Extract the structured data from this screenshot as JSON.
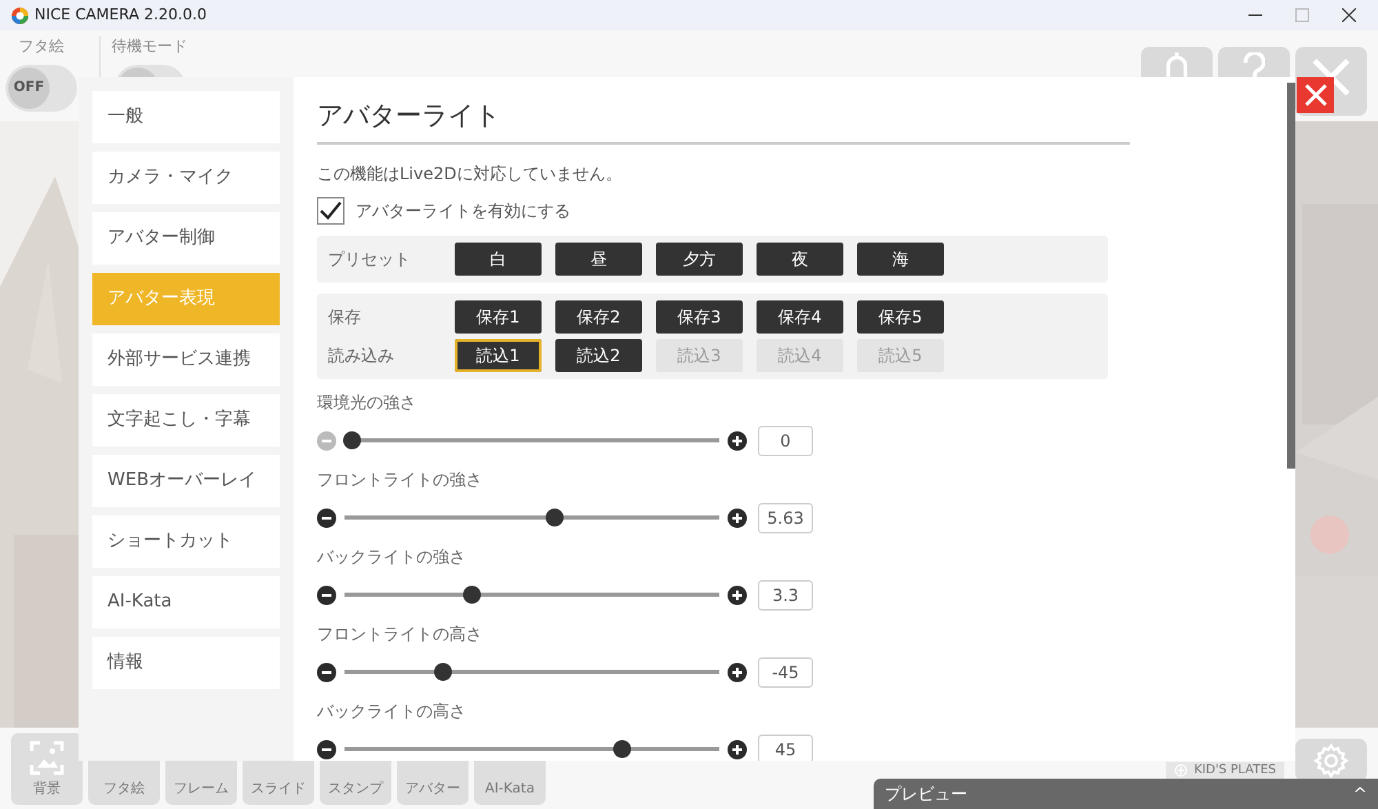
{
  "window": {
    "title": "NICE CAMERA 2.20.0.0"
  },
  "app": {
    "top_toggles": [
      {
        "label": "フタ絵",
        "state_text": "OFF",
        "on": false
      },
      {
        "label": "待機モード",
        "on": false
      }
    ],
    "bottom_toolbar": [
      {
        "label": "背景"
      },
      {
        "label": "フタ絵"
      },
      {
        "label": "フレーム"
      },
      {
        "label": "スライド"
      },
      {
        "label": "スタンプ"
      },
      {
        "label": "アバター"
      },
      {
        "label": "AI-Kata"
      }
    ],
    "badge": "KID'S PLATES",
    "preview_bar": {
      "label": "プレビュー",
      "toggle": "^"
    }
  },
  "settings": {
    "sidebar": [
      {
        "label": "一般",
        "selected": false
      },
      {
        "label": "カメラ・マイク",
        "selected": false
      },
      {
        "label": "アバター制御",
        "selected": false
      },
      {
        "label": "アバター表現",
        "selected": true
      },
      {
        "label": "外部サービス連携",
        "selected": false
      },
      {
        "label": "文字起こし・字幕",
        "selected": false
      },
      {
        "label": "WEBオーバーレイ",
        "selected": false
      },
      {
        "label": "ショートカット",
        "selected": false
      },
      {
        "label": "AI-Kata",
        "selected": false
      },
      {
        "label": "情報",
        "selected": false
      }
    ],
    "title": "アバターライト",
    "notice": "この機能はLive2Dに対応していません。",
    "enable": {
      "label": "アバターライトを有効にする",
      "checked": true
    },
    "preset": {
      "label": "プリセット",
      "buttons": [
        "白",
        "昼",
        "夕方",
        "夜",
        "海"
      ]
    },
    "save": {
      "label": "保存",
      "buttons": [
        "保存1",
        "保存2",
        "保存3",
        "保存4",
        "保存5"
      ]
    },
    "load": {
      "label": "読み込み",
      "buttons": [
        {
          "label": "読込1",
          "selected": true,
          "disabled": false
        },
        {
          "label": "読込2",
          "selected": false,
          "disabled": false
        },
        {
          "label": "読込3",
          "selected": false,
          "disabled": true
        },
        {
          "label": "読込4",
          "selected": false,
          "disabled": true
        },
        {
          "label": "読込5",
          "selected": false,
          "disabled": true
        }
      ]
    },
    "sliders": [
      {
        "label": "環境光の強さ",
        "level": 0.02,
        "value": "0",
        "minus_disabled": true
      },
      {
        "label": "フロントライトの強さ",
        "level": 0.56,
        "value": "5.63",
        "minus_disabled": false
      },
      {
        "label": "バックライトの強さ",
        "level": 0.34,
        "value": "3.3",
        "minus_disabled": false
      },
      {
        "label": "フロントライトの高さ",
        "level": 0.26,
        "value": "-45",
        "minus_disabled": false
      },
      {
        "label": "バックライトの高さ",
        "level": 0.74,
        "value": "45",
        "minus_disabled": false
      }
    ]
  }
}
